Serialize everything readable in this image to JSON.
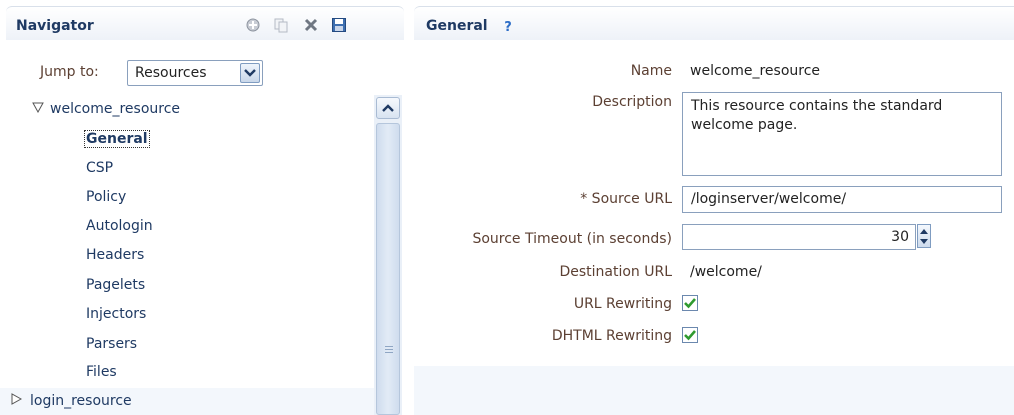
{
  "navigator": {
    "title": "Navigator",
    "toolbar": {
      "add_icon": "add-icon",
      "copy_icon": "copy-icon",
      "delete_icon": "delete-icon",
      "save_icon": "save-icon"
    },
    "jump_to": {
      "label": "Jump to:",
      "value": "Resources"
    },
    "tree": {
      "root": {
        "label": "welcome_resource",
        "expanded": true
      },
      "children": [
        "General",
        "CSP",
        "Policy",
        "Autologin",
        "Headers",
        "Pagelets",
        "Injectors",
        "Parsers",
        "Files"
      ],
      "selected": "General",
      "next_root": {
        "label": "login_resource",
        "expanded": false
      }
    }
  },
  "general": {
    "title": "General",
    "help_glyph": "?",
    "fields": {
      "name": {
        "label": "Name",
        "value": "welcome_resource"
      },
      "description": {
        "label": "Description",
        "value": "This resource contains the standard welcome page."
      },
      "source_url": {
        "label": "* Source URL",
        "value": "/loginserver/welcome/"
      },
      "source_timeout": {
        "label": "Source Timeout (in seconds)",
        "value": "30"
      },
      "destination_url": {
        "label": "Destination URL",
        "value": "/welcome/"
      },
      "url_rewriting": {
        "label": "URL Rewriting",
        "checked": true
      },
      "dhtml_rewriting": {
        "label": "DHTML Rewriting",
        "checked": true
      }
    }
  },
  "colors": {
    "header_text": "#1f3a63",
    "label_text": "#5c4033",
    "check_green": "#2f9a2f"
  }
}
